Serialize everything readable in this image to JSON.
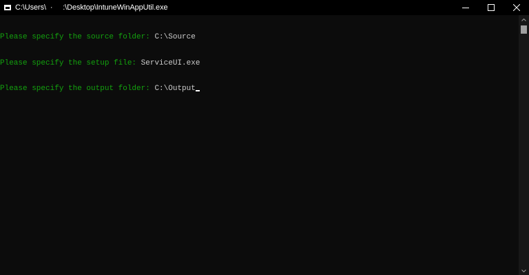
{
  "window": {
    "title": "C:\\Users\\  ·     :\\Desktop\\IntuneWinAppUtil.exe"
  },
  "console": {
    "lines": [
      {
        "prompt": "Please specify the source folder: ",
        "value": "C:\\Source"
      },
      {
        "prompt": "Please specify the setup file: ",
        "value": "ServiceUI.exe"
      },
      {
        "prompt": "Please specify the output folder: ",
        "value": "C:\\Output"
      }
    ]
  },
  "icons": {
    "app": "console-app-icon",
    "minimize": "minimize-icon",
    "maximize": "maximize-icon",
    "close": "close-icon",
    "scroll_up": "scroll-up-arrow-icon",
    "scroll_down": "scroll-down-arrow-icon"
  },
  "colors": {
    "background": "#0c0c0c",
    "titlebar": "#000000",
    "prompt_text": "#13a10e",
    "input_text": "#cccccc",
    "scrollbar_track": "#171717",
    "scrollbar_thumb": "#a0a0a0"
  }
}
